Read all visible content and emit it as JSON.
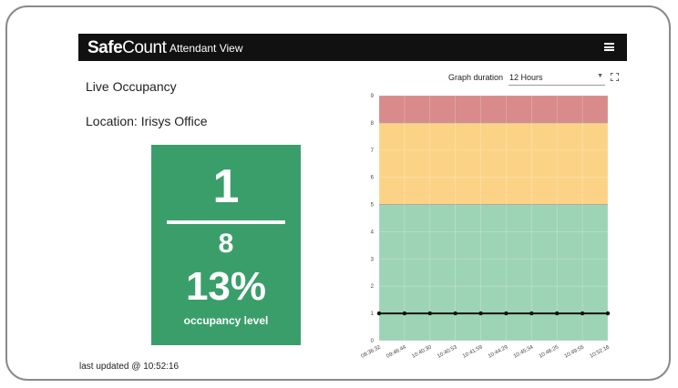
{
  "app": {
    "brand_bold": "Safe",
    "brand_thin": "Count",
    "view_title": "Attendant View",
    "menu_icon": "hamburger-menu-icon"
  },
  "main": {
    "title": "Live Occupancy",
    "location": "Location: Irisys Office",
    "occupancy": {
      "count": "1",
      "max": "8",
      "percent": "13%",
      "caption": "occupancy level",
      "color": "#3a9e6a"
    },
    "last_updated": "last updated @ 10:52:16"
  },
  "graph_controls": {
    "duration_label": "Graph duration",
    "duration_value": "12 Hours",
    "fullscreen_icon": "fullscreen-icon"
  },
  "chart_data": {
    "type": "line",
    "title": "",
    "xlabel": "",
    "ylabel": "",
    "ylim": [
      0,
      9
    ],
    "yticks": [
      "0",
      "1",
      "2",
      "3",
      "4",
      "5",
      "6",
      "7",
      "8",
      "9"
    ],
    "x": [
      "08:36:32",
      "09:46:44",
      "10:40:30",
      "10:40:53",
      "10:41:59",
      "10:44:29",
      "10:45:34",
      "10:46:25",
      "10:49:55",
      "10:52:16"
    ],
    "series": [
      {
        "values": [
          1,
          1,
          1,
          1,
          1,
          1,
          1,
          1,
          1,
          1
        ]
      }
    ],
    "bands": [
      {
        "from": 0,
        "to": 5,
        "color": "#9dd4b6"
      },
      {
        "from": 5,
        "to": 8,
        "color": "#fcd386"
      },
      {
        "from": 8,
        "to": 9,
        "color": "#d98a8a"
      }
    ],
    "grid": true,
    "line_color": "#111111"
  }
}
